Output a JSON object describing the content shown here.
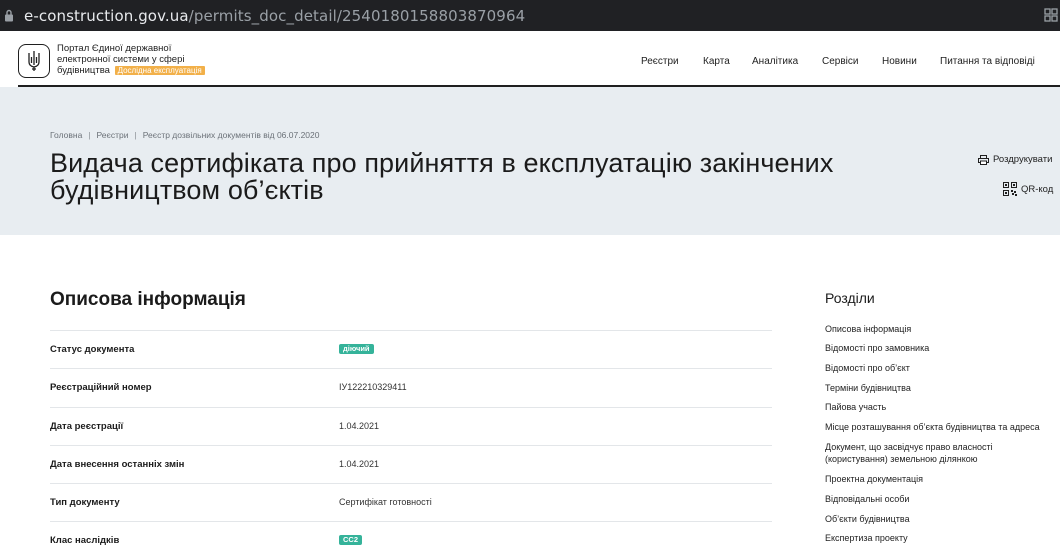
{
  "browser": {
    "url_domain": "e-construction.gov.ua",
    "url_path": "/permits_doc_detail/2540180158803870964"
  },
  "header": {
    "portal_title": "Портал Єдиної державної електронної системи у сфері будівництва",
    "beta_badge": "Дослідна експлуатація",
    "nav": [
      "Реєстри",
      "Карта",
      "Аналітика",
      "Сервіси",
      "Новини",
      "Питання та відповіді"
    ]
  },
  "hero": {
    "breadcrumb": [
      "Головна",
      "Реєстри",
      "Реєстр дозвільних документів від 06.07.2020"
    ],
    "title": "Видача сертифіката про прийняття в експлуатацію закінчених будівництвом об’єктів",
    "print_label": "Роздрукувати",
    "qr_label": "QR-код"
  },
  "main": {
    "section_title": "Описова інформація",
    "rows": [
      {
        "label": "Статус документа",
        "value": "діючий",
        "badge": true
      },
      {
        "label": "Реєстраційний номер",
        "value": "IУ122210329411",
        "badge": false
      },
      {
        "label": "Дата реєстрації",
        "value": "1.04.2021",
        "badge": false
      },
      {
        "label": "Дата внесення останніх змін",
        "value": "1.04.2021",
        "badge": false
      },
      {
        "label": "Тип документу",
        "value": "Сертифікат готовності",
        "badge": false
      },
      {
        "label": "Клас наслідків",
        "value": "СС2",
        "badge": true
      }
    ]
  },
  "sidebar": {
    "title": "Розділи",
    "links": [
      "Описова інформація",
      "Відомості про замовника",
      "Відомості про об’єкт",
      "Терміни будівництва",
      "Пайова участь",
      "Місце розташування об’єкта будівництва та адреса",
      "Документ, що засвідчує право власності (користування) земельною ділянкою",
      "Проектна документація",
      "Відповідальні особи",
      "Об’єкти будівництва",
      "Експертиза проекту"
    ]
  },
  "colors": {
    "badge_green": "#35b39a",
    "beta_orange": "#f2b049",
    "hero_bg": "#e8edf1",
    "addressbar_bg": "#202124"
  }
}
